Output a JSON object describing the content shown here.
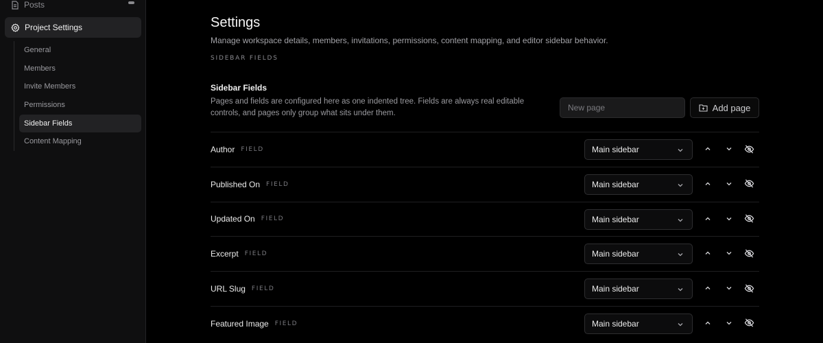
{
  "sidebar": {
    "posts_label": "Posts",
    "project_settings_label": "Project Settings",
    "sub_items": [
      {
        "label": "General",
        "active": false
      },
      {
        "label": "Members",
        "active": false
      },
      {
        "label": "Invite Members",
        "active": false
      },
      {
        "label": "Permissions",
        "active": false
      },
      {
        "label": "Sidebar Fields",
        "active": true
      },
      {
        "label": "Content Mapping",
        "active": false
      }
    ]
  },
  "main": {
    "title": "Settings",
    "description": "Manage workspace details, members, invitations, permissions, content mapping, and editor sidebar behavior.",
    "eyebrow": "SIDEBAR FIELDS",
    "section_title": "Sidebar Fields",
    "section_description": "Pages and fields are configured here as one indented tree. Fields are always real editable controls, and pages only group what sits under them.",
    "new_page_placeholder": "New page",
    "add_page_label": "Add page",
    "fields": [
      {
        "name": "Author",
        "kind": "FIELD",
        "placement": "Main sidebar"
      },
      {
        "name": "Published On",
        "kind": "FIELD",
        "placement": "Main sidebar"
      },
      {
        "name": "Updated On",
        "kind": "FIELD",
        "placement": "Main sidebar"
      },
      {
        "name": "Excerpt",
        "kind": "FIELD",
        "placement": "Main sidebar"
      },
      {
        "name": "URL Slug",
        "kind": "FIELD",
        "placement": "Main sidebar"
      },
      {
        "name": "Featured Image",
        "kind": "FIELD",
        "placement": "Main sidebar"
      }
    ]
  },
  "icons": {
    "posts": "document-icon",
    "project_settings": "gear-icon",
    "add_page": "folder-plus-icon",
    "select": "chevron-down-icon",
    "move_up": "chevron-up-icon",
    "move_down": "chevron-down-icon",
    "visibility": "eye-off-icon"
  },
  "colors": {
    "background": "#000000",
    "sidebar_bg": "#0f0f10",
    "active_item_bg": "#222224",
    "border": "#2b2b2d",
    "text_primary": "#ececec",
    "text_muted": "#9a9a9f"
  }
}
